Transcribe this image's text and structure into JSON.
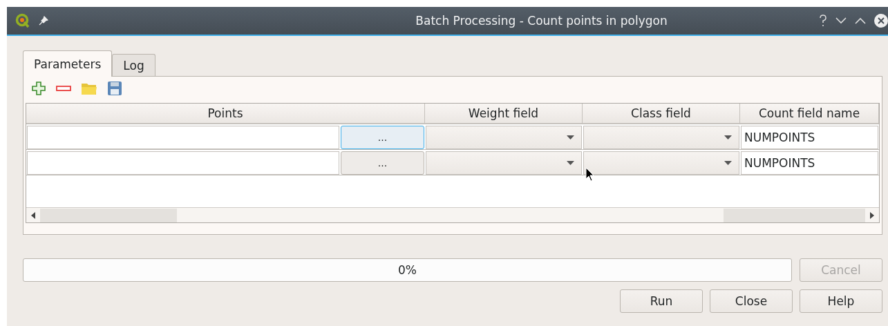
{
  "window": {
    "title": "Batch Processing - Count points in polygon"
  },
  "tabs": [
    {
      "label": "Parameters",
      "selected": true
    },
    {
      "label": "Log",
      "selected": false
    }
  ],
  "table": {
    "columns": [
      "Points",
      "Weight field",
      "Class field",
      "Count field name"
    ],
    "rows": [
      {
        "browse_button": "...",
        "focused": true,
        "count_field_name": "NUMPOINTS"
      },
      {
        "browse_button": "...",
        "focused": false,
        "count_field_name": "NUMPOINTS"
      }
    ]
  },
  "progress": {
    "level": 0,
    "reading": "0%"
  },
  "cancel_button": {
    "label": "Cancel",
    "disabled": true
  },
  "buttons": [
    {
      "label": "Run",
      "disabled": false
    },
    {
      "label": "Close",
      "disabled": false
    },
    {
      "label": "Help",
      "disabled": false
    }
  ]
}
